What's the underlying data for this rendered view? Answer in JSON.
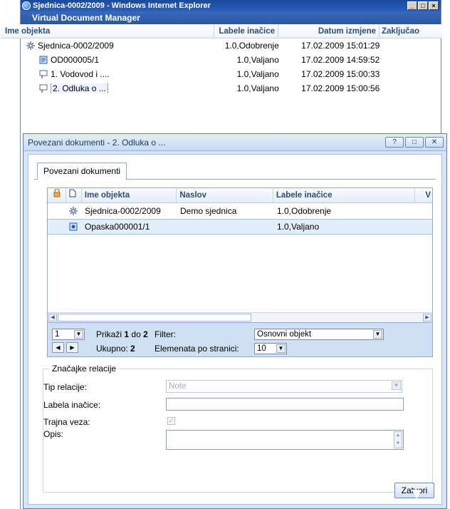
{
  "ie": {
    "title": "Sjednica-0002/2009 - Windows Internet Explorer",
    "min": "_",
    "max": "□",
    "close": "×"
  },
  "app": {
    "title": "Virtual Document Manager"
  },
  "tree": {
    "headers": [
      "Ime objekta",
      "Labele inačice",
      "Datum izmjene",
      "Zaključao"
    ],
    "rows": [
      {
        "name": "Sjednica-0002/2009",
        "label": "1.0,Odobrenje",
        "date": "17.02.2009 15:01:29",
        "icon": "meeting-icon"
      },
      {
        "name": "OD000005/1",
        "label": "1.0,Valjano",
        "date": "17.02.2009 14:59:52",
        "icon": "document-icon"
      },
      {
        "name": "1. Vodovod i ....",
        "label": "1.0,Valjano",
        "date": "17.02.2009 15:00:33",
        "icon": "agenda-item-icon"
      },
      {
        "name": "2. Odluka o ...",
        "label": "1.0,Valjano",
        "date": "17.02.2009 15:00:56",
        "icon": "agenda-item-icon"
      }
    ]
  },
  "modal": {
    "title": "Povezani dokumenti - 2. Odluka o ...",
    "help": "?",
    "max": "□",
    "close": "✕",
    "tab": "Povezani dokumenti",
    "grid": {
      "headers": [
        "Ime objekta",
        "Naslov",
        "Labele inačice",
        "V"
      ],
      "rows": [
        {
          "name": "Sjednica-0002/2009",
          "title": "Demo sjednica",
          "label": "1.0,Odobrenje"
        },
        {
          "name": "Opaska000001/1",
          "title": "",
          "label": "1.0,Valjano"
        }
      ]
    },
    "pager": {
      "page": "1",
      "showing_prefix": "Prikaži",
      "from": "1",
      "to_word": "do",
      "to": "2",
      "total_label": "Ukupno:",
      "total": "2",
      "filter_label": "Filter:",
      "filter_value": "Osnovni objekt",
      "per_page_label": "Elemenata po stranici:",
      "per_page": "10"
    },
    "relation": {
      "legend": "Značajke relacije",
      "type_label": "Tip relacije:",
      "type_value": "Note",
      "version_label": "Labela inačice:",
      "version_value": "",
      "permanent_label": "Trajna veza:",
      "desc_label": "Opis:",
      "desc_value": ""
    },
    "close_button": "Zatvori"
  }
}
